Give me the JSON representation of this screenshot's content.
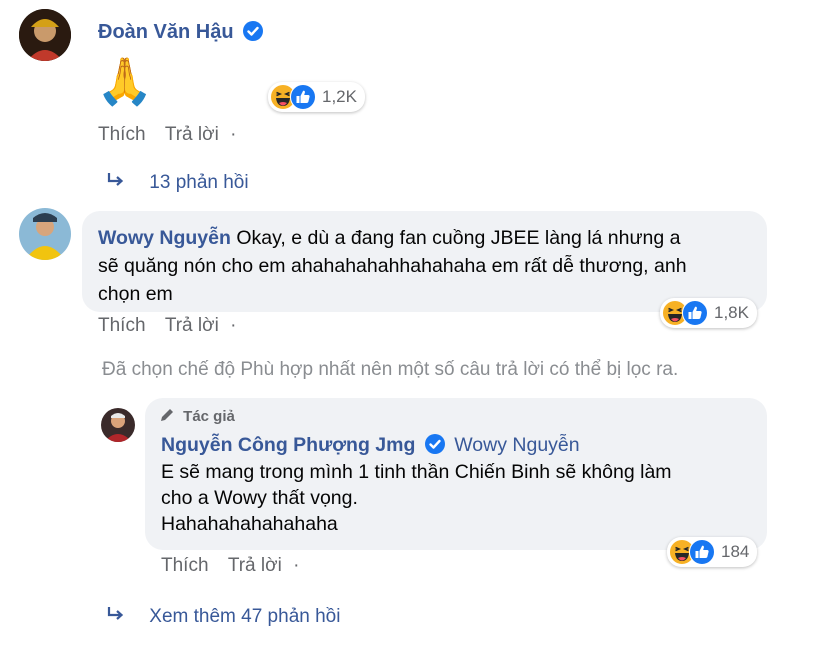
{
  "comment1": {
    "author": "Đoàn Văn Hậu",
    "emoji": "🙏",
    "reactions": {
      "icons": [
        "haha-icon",
        "like-icon"
      ],
      "count": "1,2K"
    },
    "actions": {
      "like": "Thích",
      "reply": "Trả lời",
      "sep": "·"
    },
    "replies_link": "13 phản hồi"
  },
  "comment2": {
    "author": "Wowy Nguyễn",
    "text_line1": "Okay, e dù a đang fan cuồng JBEE làng lá nhưng a",
    "text_line2": "sẽ quăng nón cho em ahahahahahhahahaha em rất dễ thương, anh",
    "text_line3": "chọn em",
    "reactions": {
      "icons": [
        "haha-icon",
        "like-icon"
      ],
      "count": "1,8K"
    },
    "actions": {
      "like": "Thích",
      "reply": "Trả lời",
      "sep": "·"
    }
  },
  "filter_notice": "Đã chọn chế độ Phù hợp nhất nên một số câu trả lời có thể bị lọc ra.",
  "reply1": {
    "badge": "Tác giả",
    "author": "Nguyễn Công Phượng Jmg",
    "tag": "Wowy Nguyễn",
    "text_line1": "E sẽ mang trong mình 1 tinh thần Chiến Binh sẽ không làm",
    "text_line2": "cho a Wowy thất vọng.",
    "text_line3": "Hahahahahahahaha",
    "reactions": {
      "icons": [
        "haha-icon",
        "like-icon"
      ],
      "count": "184"
    },
    "actions": {
      "like": "Thích",
      "reply": "Trả lời",
      "sep": "·"
    }
  },
  "more_replies": "Xem thêm 47 phản hồi",
  "colors": {
    "link": "#385898",
    "muted": "#65676b",
    "bubble": "#f0f2f5",
    "verified": "#1877f2"
  }
}
